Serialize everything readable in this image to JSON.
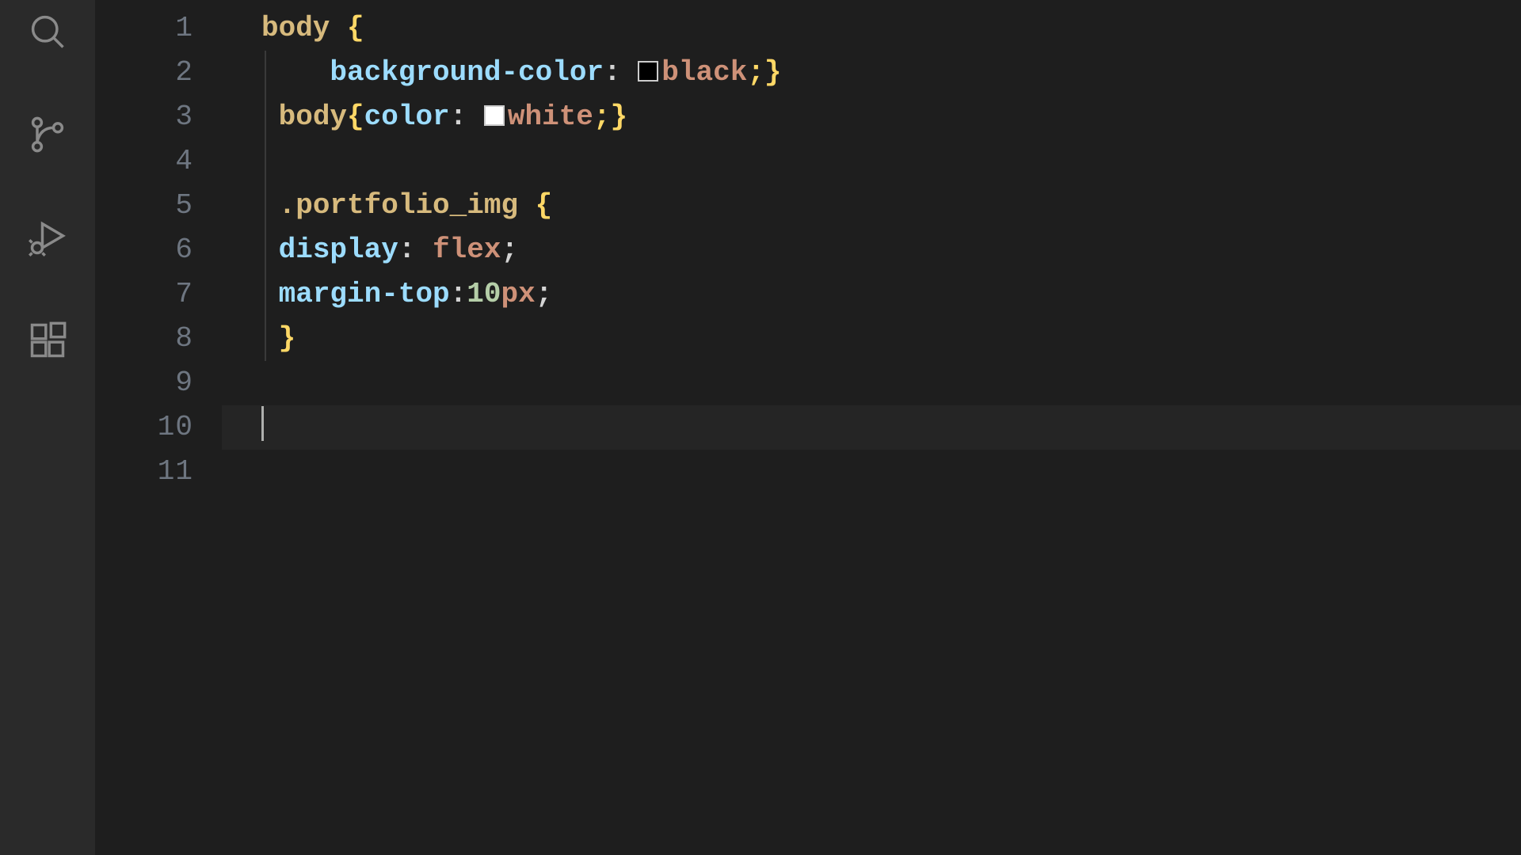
{
  "activityBar": {
    "items": [
      {
        "name": "search-icon"
      },
      {
        "name": "source-control-icon"
      },
      {
        "name": "run-debug-icon"
      },
      {
        "name": "extensions-icon"
      }
    ]
  },
  "editor": {
    "lineNumbers": [
      "1",
      "2",
      "3",
      "4",
      "5",
      "6",
      "7",
      "8",
      "9",
      "10",
      "11"
    ],
    "activeLine": 10,
    "code": {
      "l1": {
        "selector": "body",
        "brace_open": " {"
      },
      "l2": {
        "indent": "    ",
        "prop": "background-color",
        "colon": ": ",
        "swatch": "black",
        "value": "black",
        "end": ";}"
      },
      "l3": {
        "selector": "body",
        "brace_open": "{",
        "prop": "color",
        "colon": ": ",
        "swatch": "white",
        "value": "white",
        "end": ";}"
      },
      "l5": {
        "selector": ".portfolio_img",
        "brace_open": " {"
      },
      "l6": {
        "prop": "display",
        "colon": ": ",
        "value": "flex",
        "semi": ";"
      },
      "l7": {
        "prop": "margin-top",
        "colon": ":",
        "num": "10",
        "unit": "px",
        "semi": ";"
      },
      "l8": {
        "brace_close": "}"
      }
    }
  }
}
